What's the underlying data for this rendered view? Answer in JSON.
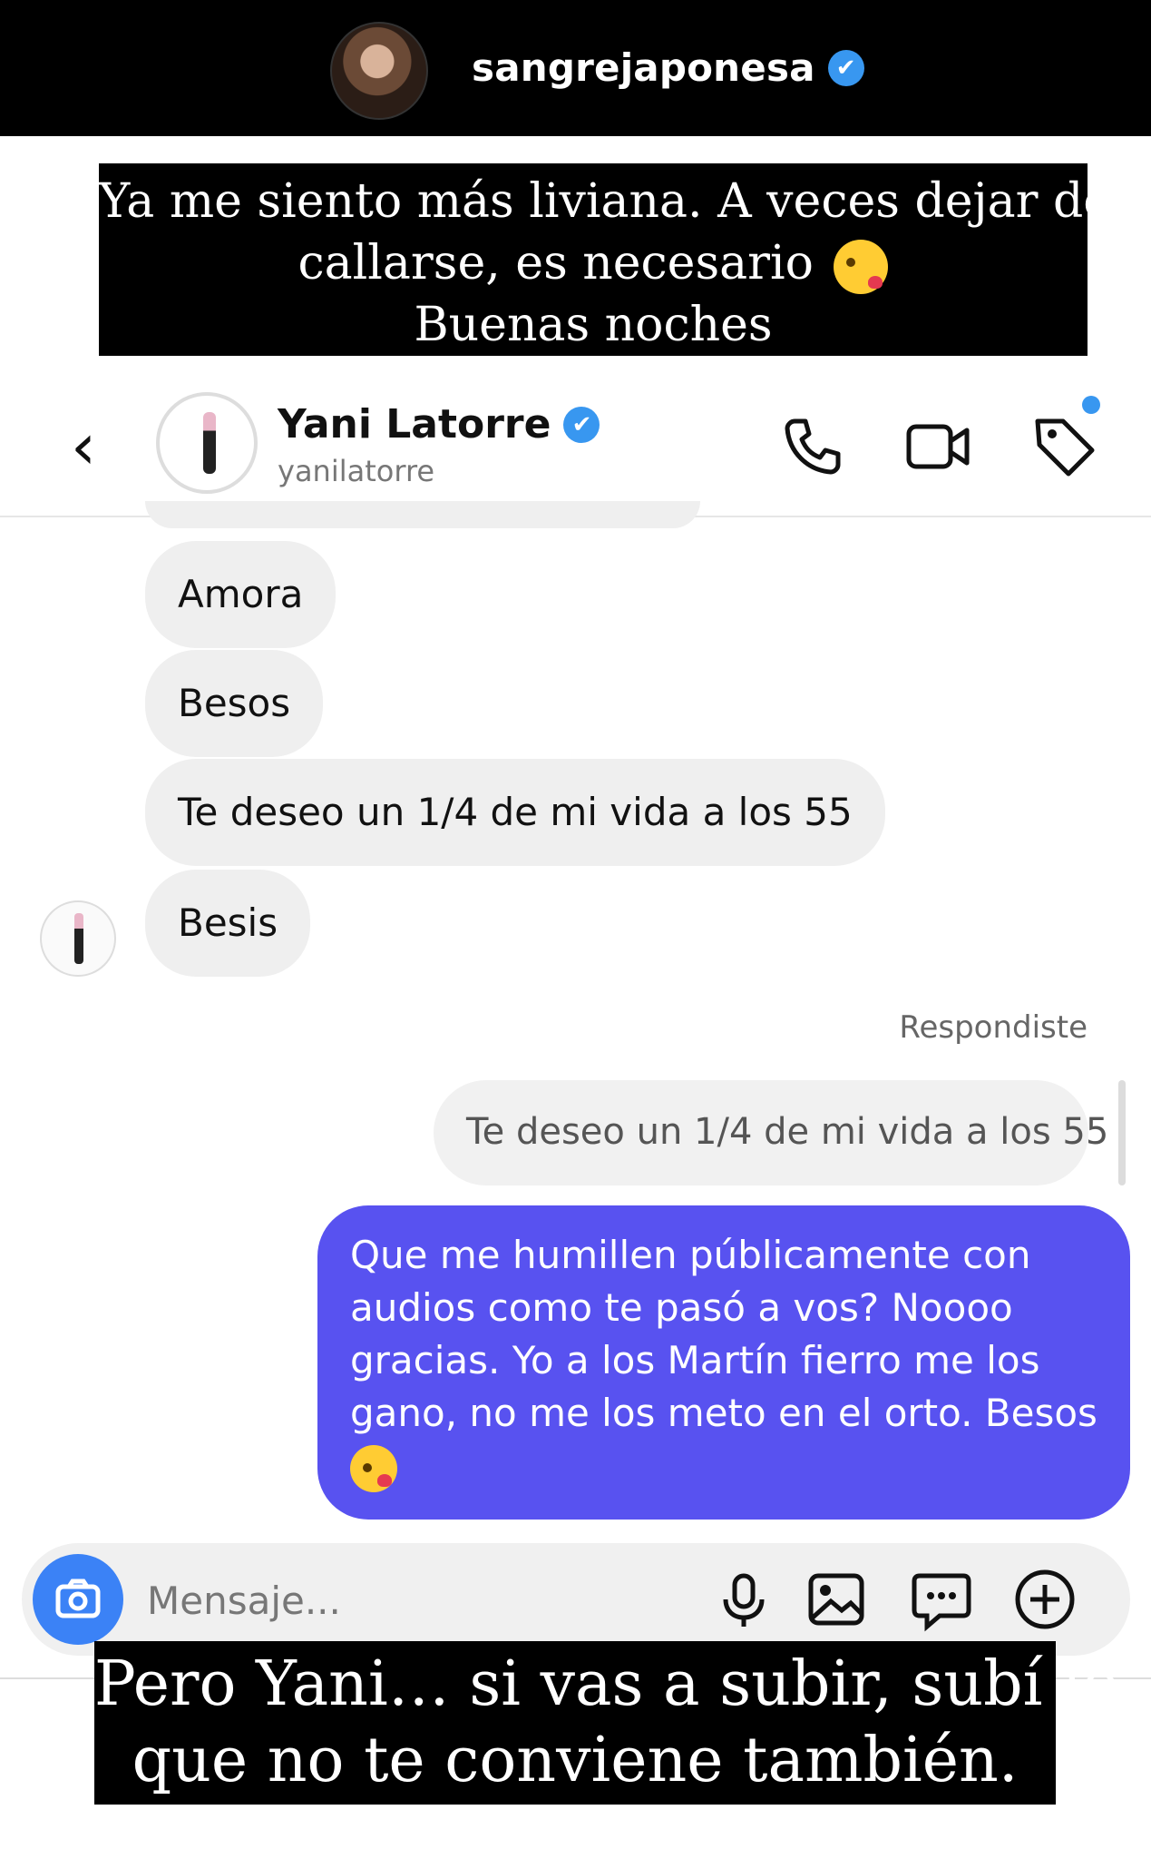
{
  "story": {
    "username": "sangrejaponesa",
    "verified_mark": "✔",
    "caption_top": [
      "Ya me siento más liviana. A veces dejar de",
      "callarse, es necesario",
      "Buenas noches"
    ],
    "caption_bottom": [
      "Pero Yani… si vas a subir, subí lo",
      "que no te conviene también."
    ]
  },
  "chat": {
    "contact_name": "Yani Latorre",
    "contact_handle": "yanilatorre",
    "verified_mark": "✔",
    "back_glyph": "‹",
    "header_icons": [
      "phone-icon",
      "video-camera-icon",
      "tag-icon"
    ],
    "received_messages": [
      "Amora",
      "Besos",
      "Te deseo un 1/4 de mi vida a los 55",
      "Besis"
    ],
    "replied_label": "Respondiste",
    "quoted_message": "Te deseo un 1/4 de mi vida a los 55",
    "sent_message_lines": [
      "Que me humillen públicamente con",
      "audios como te pasó a vos? Noooo",
      "gracias. Yo a los Martín fierro me los",
      "gano, no me los meto en el orto. Besos"
    ],
    "composer_placeholder": "Mensaje...",
    "composer_icons": [
      "microphone-icon",
      "gallery-icon",
      "sticker-icon",
      "plus-icon"
    ]
  },
  "colors": {
    "sent_bubble": "#5852f0",
    "received_bubble": "#efefef",
    "verified": "#3897f0",
    "camera_button": "#3b82f6"
  }
}
